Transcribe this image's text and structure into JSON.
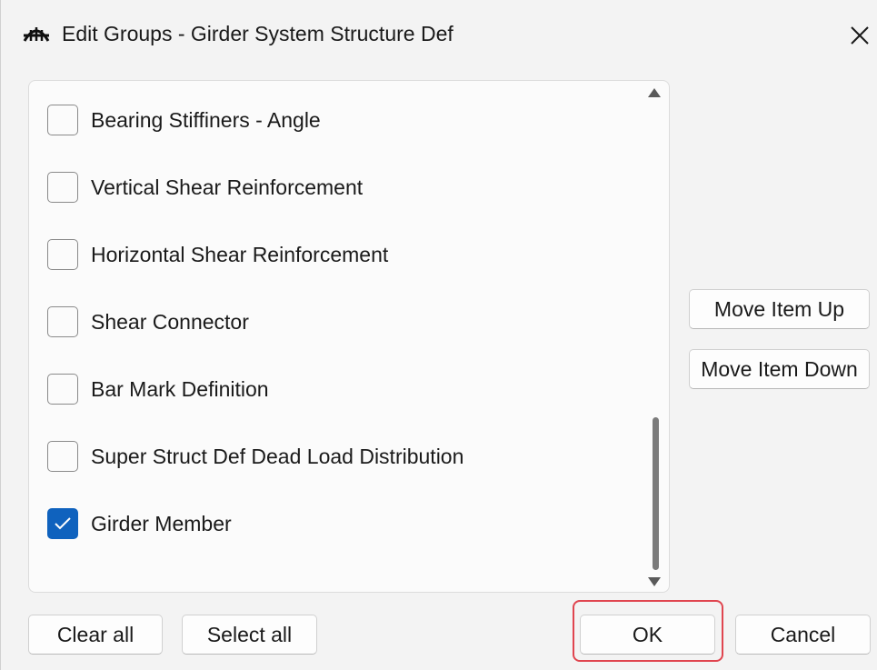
{
  "window": {
    "title": "Edit Groups - Girder System Structure Def",
    "app_icon": "bridge-icon",
    "close_icon": "close-icon"
  },
  "list": {
    "items": [
      {
        "label": "Bearing Stiffiners - Angle",
        "checked": false
      },
      {
        "label": "Vertical Shear Reinforcement",
        "checked": false
      },
      {
        "label": "Horizontal Shear Reinforcement",
        "checked": false
      },
      {
        "label": "Shear Connector",
        "checked": false
      },
      {
        "label": "Bar Mark Definition",
        "checked": false
      },
      {
        "label": "Super Struct Def Dead Load Distribution",
        "checked": false
      },
      {
        "label": "Girder Member",
        "checked": true
      }
    ]
  },
  "side_buttons": {
    "move_up": "Move Item Up",
    "move_down": "Move Item Down"
  },
  "footer": {
    "clear_all": "Clear all",
    "select_all": "Select all",
    "ok": "OK",
    "cancel": "Cancel"
  },
  "colors": {
    "accent": "#0f62be",
    "highlight": "#e0454f"
  }
}
